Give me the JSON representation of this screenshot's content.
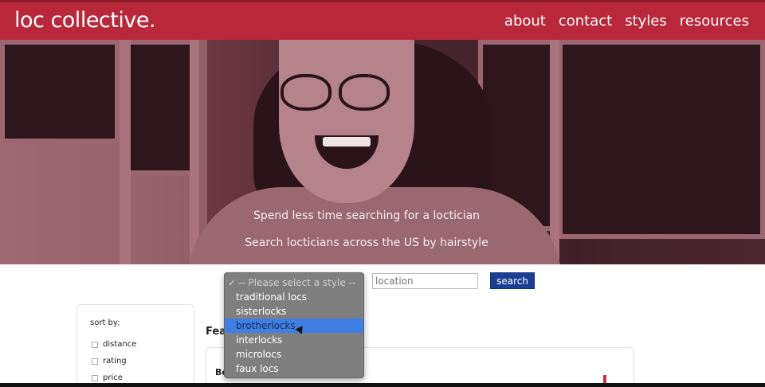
{
  "header": {
    "brand": "loc collective.",
    "nav": [
      {
        "label": "about"
      },
      {
        "label": "contact"
      },
      {
        "label": "styles"
      },
      {
        "label": "resources"
      }
    ]
  },
  "hero": {
    "line1": "Spend less time searching for a loctician",
    "line2": "Search locticians across the US by hairstyle"
  },
  "search": {
    "style_dropdown": {
      "placeholder": "-- Please select a style --",
      "options": [
        "traditional locs",
        "sisterlocks",
        "brotherlocks",
        "interlocks",
        "microlocs",
        "faux locs"
      ],
      "highlighted": "brotherlocks"
    },
    "location_placeholder": "location",
    "button_label": "search"
  },
  "sort": {
    "title": "sort by:",
    "options": [
      "distance",
      "rating",
      "price"
    ]
  },
  "featured": {
    "heading": "Fea",
    "card_name": "Be"
  },
  "colors": {
    "brand_red": "#b8283a",
    "search_blue": "#1c3f95",
    "highlight_blue": "#3f7fe3"
  }
}
